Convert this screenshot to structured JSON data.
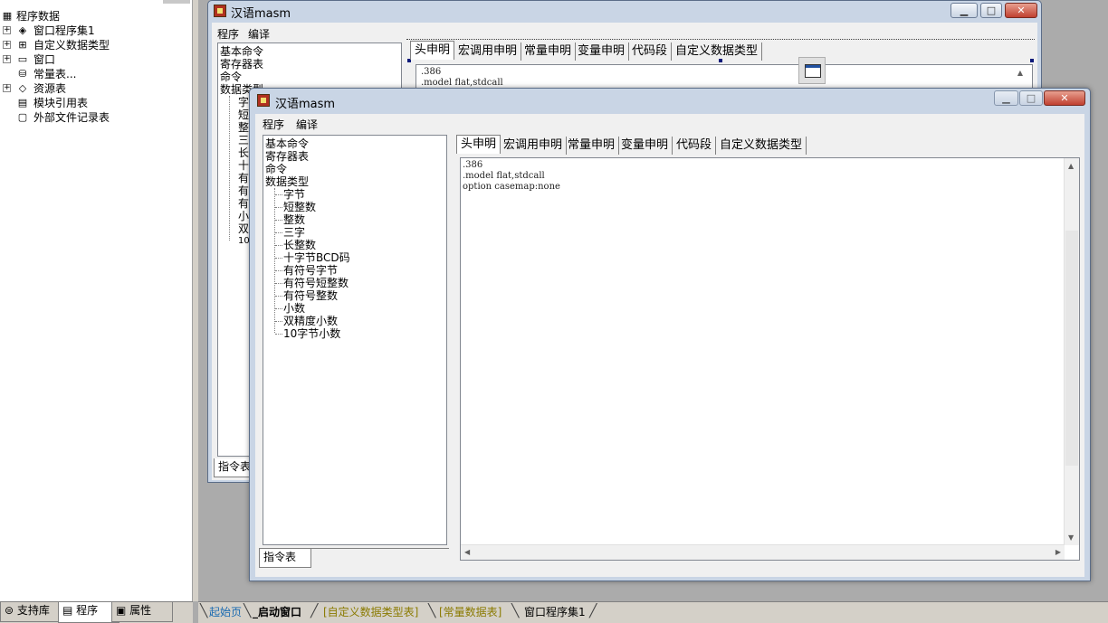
{
  "left_panel": {
    "items": [
      {
        "label": "程序数据",
        "icon": "program-data-icon"
      },
      {
        "label": "窗口程序集1",
        "icon": "assembly-icon"
      },
      {
        "label": "自定义数据类型",
        "icon": "custom-type-icon"
      },
      {
        "label": "窗口",
        "icon": "window-icon"
      },
      {
        "label": "常量表...",
        "icon": "constant-table-icon"
      },
      {
        "label": "资源表",
        "icon": "resource-icon"
      },
      {
        "label": "模块引用表",
        "icon": "module-ref-icon"
      },
      {
        "label": "外部文件记录表",
        "icon": "external-file-icon"
      }
    ],
    "tabs": [
      "支持库",
      "程序",
      "属性"
    ]
  },
  "doc_tabs": [
    {
      "label": "起始页",
      "color": "#1a6ab0"
    },
    {
      "label": "_启动窗口",
      "color": "#000000"
    },
    {
      "label": "[自定义数据类型表]",
      "color": "#8a7a00"
    },
    {
      "label": "[常量数据表]",
      "color": "#8a7a00"
    },
    {
      "label": "窗口程序集1",
      "color": "#000000"
    }
  ],
  "back_window": {
    "title": "汉语masm",
    "menu": [
      "程序",
      "编译"
    ],
    "list": [
      "基本命令",
      "寄存器表",
      "命令",
      "数据类型"
    ],
    "sub_visible": [
      "字",
      "短",
      "整",
      "三",
      "长",
      "十",
      "有",
      "有",
      "有",
      "小",
      "双",
      "10"
    ],
    "tabs": [
      "头申明",
      "宏调用申明",
      "常量申明",
      "变量申明",
      "代码段",
      "自定义数据类型"
    ],
    "code": [
      ".386",
      ".model flat,stdcall"
    ],
    "bottom_tab": "指令表"
  },
  "front_window": {
    "title": "汉语masm",
    "menu": [
      "程序",
      "编译"
    ],
    "list": [
      "基本命令",
      "寄存器表",
      "命令",
      "数据类型"
    ],
    "data_types": [
      "字节",
      "短整数",
      "整数",
      "三字",
      "长整数",
      "十字节BCD码",
      "有符号字节",
      "有符号短整数",
      "有符号整数",
      "小数",
      "双精度小数",
      "10字节小数"
    ],
    "tabs": [
      "头申明",
      "宏调用申明",
      "常量申明",
      "变量申明",
      "代码段",
      "自定义数据类型"
    ],
    "code": [
      ".386",
      ".model flat,stdcall",
      "option casemap:none"
    ],
    "bottom_tab": "指令表"
  },
  "colors": {
    "title_bar": "#c9d5e5",
    "close_button": "#c04030",
    "desktop": "#ababab"
  }
}
